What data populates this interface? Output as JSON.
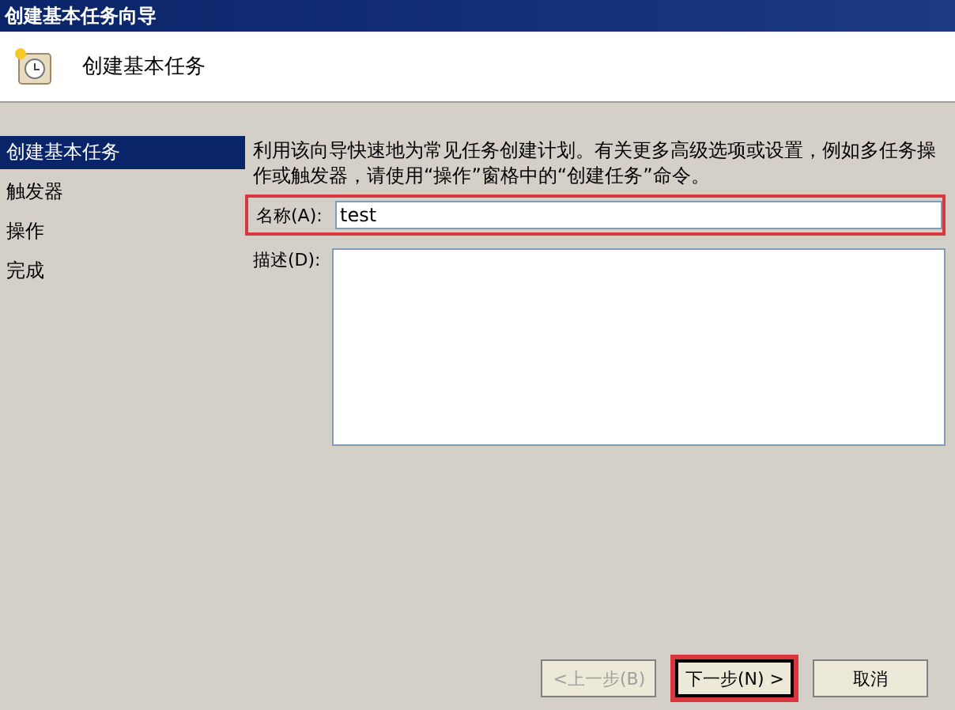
{
  "window": {
    "title": "创建基本任务向导"
  },
  "header": {
    "title": "创建基本任务"
  },
  "steps": [
    {
      "label": "创建基本任务",
      "selected": true
    },
    {
      "label": "触发器",
      "selected": false
    },
    {
      "label": "操作",
      "selected": false
    },
    {
      "label": "完成",
      "selected": false
    }
  ],
  "intro": "利用该向导快速地为常见任务创建计划。有关更多高级选项或设置，例如多任务操作或触发器，请使用“操作”窗格中的“创建任务”命令。",
  "name_field": {
    "label": "名称(A):",
    "value": "test",
    "highlighted": true
  },
  "description_field": {
    "label": "描述(D):"
  },
  "buttons": [
    {
      "label": "<上一步(B)",
      "disabled": true,
      "default": false,
      "highlighted": false
    },
    {
      "label": "下一步(N) >",
      "disabled": false,
      "default": true,
      "highlighted": true
    },
    {
      "label": "取消",
      "disabled": false,
      "default": false,
      "highlighted": false
    }
  ]
}
